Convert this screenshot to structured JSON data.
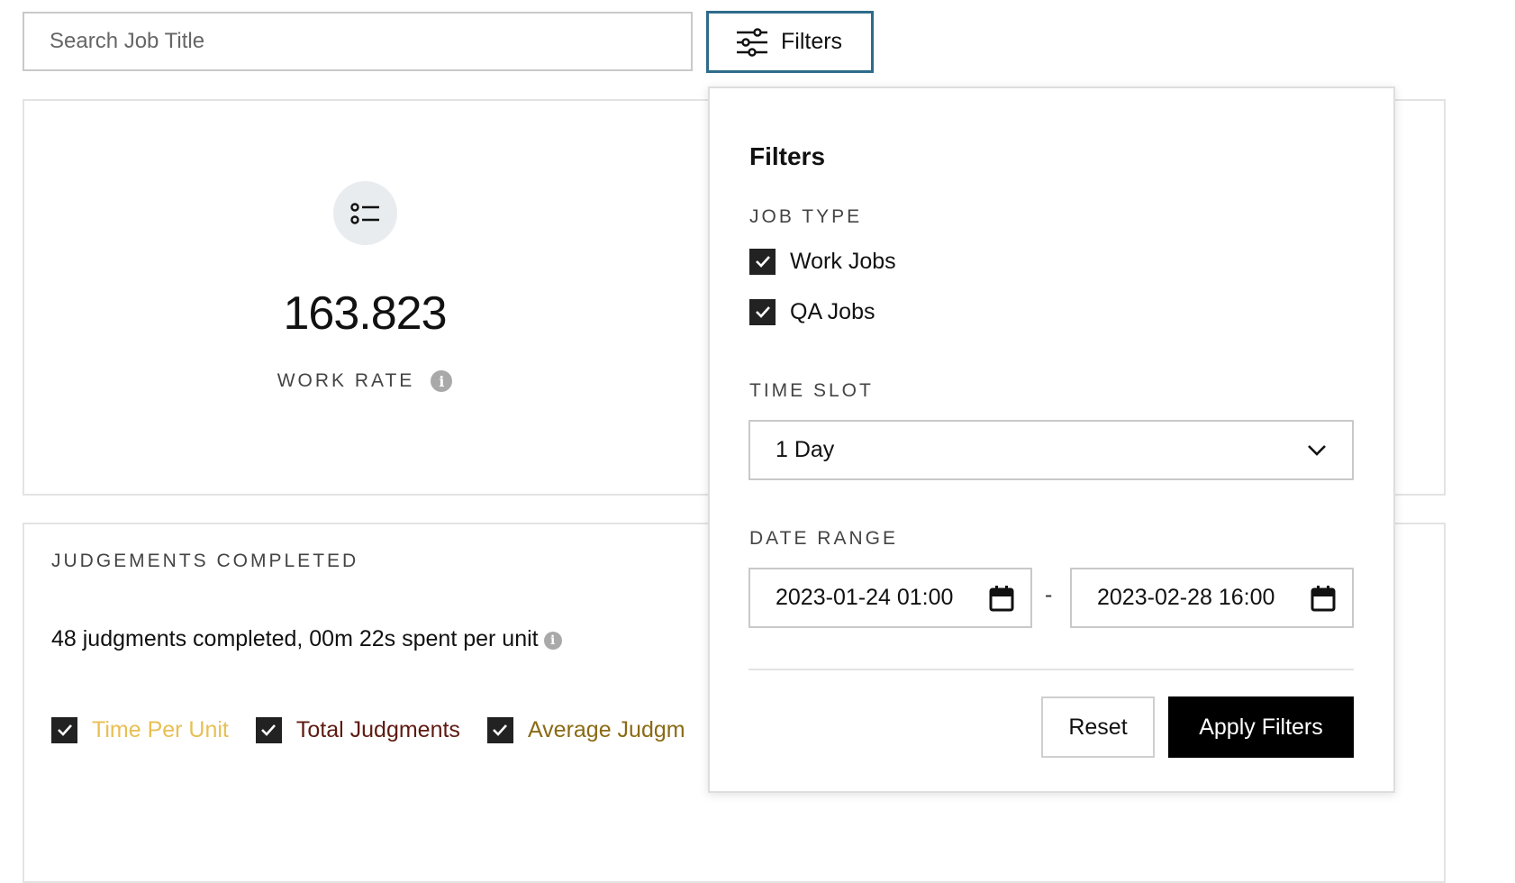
{
  "search": {
    "placeholder": "Search Job Title"
  },
  "filters_button": {
    "label": "Filters"
  },
  "work_rate_card": {
    "value": "163.823",
    "label": "WORK RATE"
  },
  "judgements_card": {
    "title": "JUDGEMENTS COMPLETED",
    "summary": "48 judgments completed, 00m 22s spent per unit",
    "legend": [
      {
        "label": "Time Per Unit",
        "color": "#e8bf52",
        "checked": true
      },
      {
        "label": "Total Judgments",
        "color": "#5e1a12",
        "checked": true
      },
      {
        "label": "Average Judgm",
        "color": "#8a6a14",
        "checked": true
      }
    ]
  },
  "filters_panel": {
    "title": "Filters",
    "job_type_label": "JOB TYPE",
    "job_types": [
      {
        "label": "Work Jobs",
        "checked": true
      },
      {
        "label": "QA Jobs",
        "checked": true
      }
    ],
    "time_slot_label": "TIME SLOT",
    "time_slot_value": "1 Day",
    "date_range_label": "DATE RANGE",
    "date_start": "2023-01-24 01:00",
    "date_separator": "-",
    "date_end": "2023-02-28 16:00",
    "reset_label": "Reset",
    "apply_label": "Apply Filters"
  }
}
